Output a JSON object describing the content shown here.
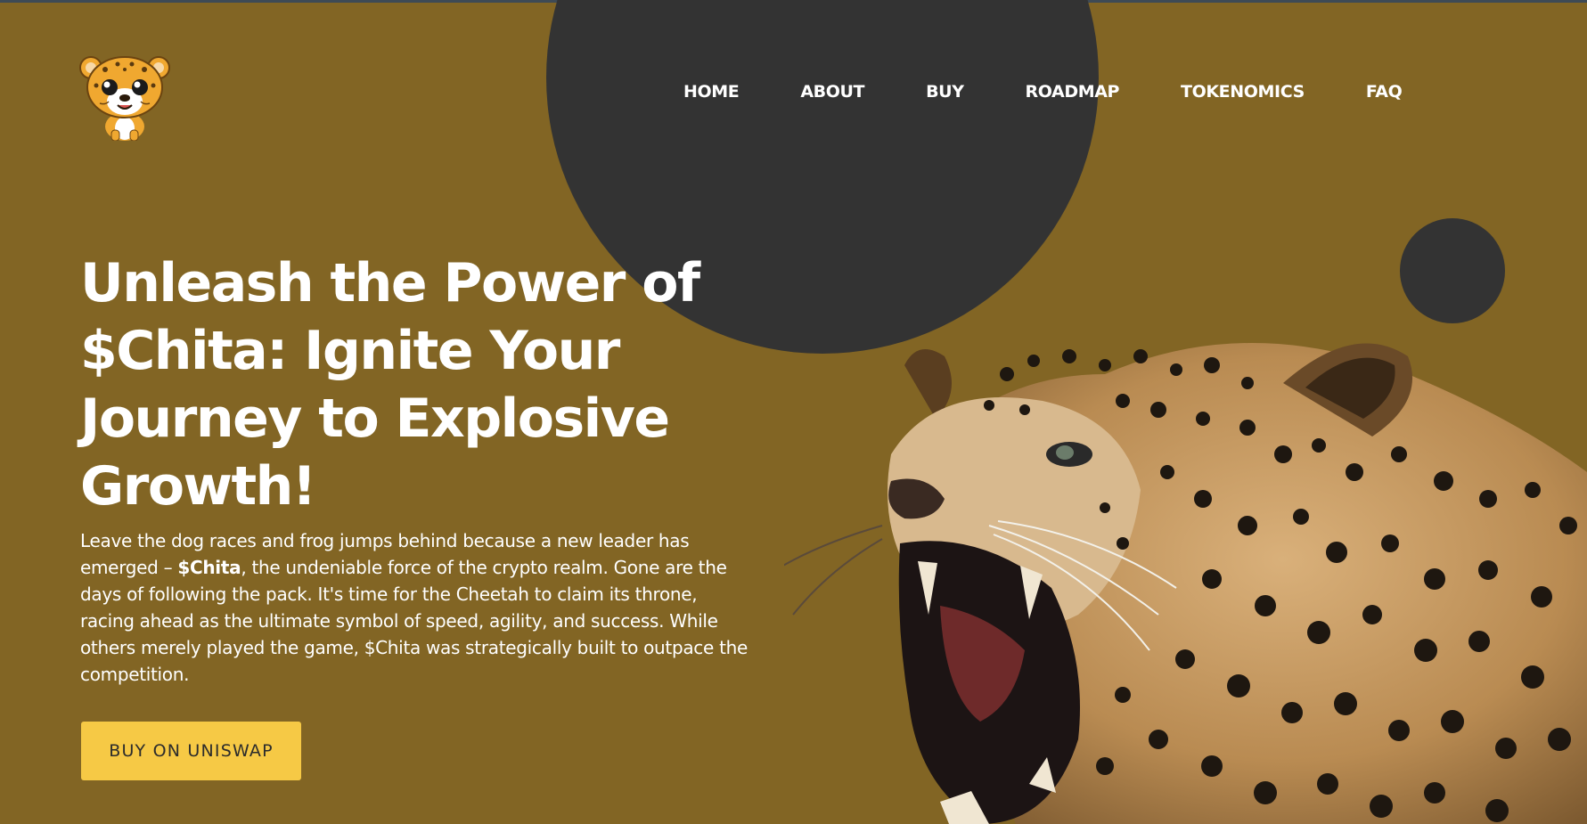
{
  "nav": {
    "items": [
      "HOME",
      "ABOUT",
      "BUY",
      "ROADMAP",
      "TOKENOMICS",
      "FAQ"
    ]
  },
  "hero": {
    "title": "Unleash the Power of $Chita: Ignite Your Journey to Explosive Growth!",
    "description_before": "Leave the dog races and frog jumps behind because a new leader has emerged – ",
    "description_bold": "$Chita",
    "description_after": ", the undeniable force of the crypto realm. Gone are the days of following the pack. It's time for the Cheetah to claim its throne, racing ahead as the ultimate symbol of speed, agility, and success. While others merely played the game, $Chita was strategically built to outpace the competition.",
    "cta_label": "BUY ON UNISWAP"
  },
  "colors": {
    "background": "#826524",
    "circle": "#333333",
    "cta": "#f6c945",
    "text": "#ffffff"
  },
  "icons": {
    "logo": "cheetah-cub-logo",
    "hero_image": "roaring-jaguar-image"
  }
}
